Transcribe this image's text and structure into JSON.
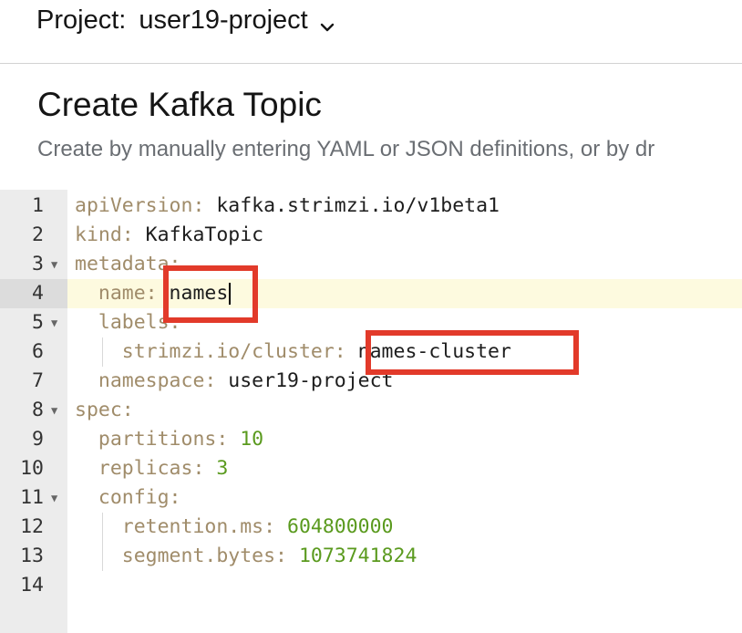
{
  "header": {
    "project_label": "Project:",
    "project_name": "user19-project",
    "chevron_icon": "chevron-down-icon"
  },
  "page": {
    "title": "Create Kafka Topic",
    "description": "Create by manually entering YAML or JSON definitions, or by dr"
  },
  "editor": {
    "lines": [
      {
        "num": "1",
        "key": "apiVersion:",
        "value": " kafka.strimzi.io/v1beta1"
      },
      {
        "num": "2",
        "key": "kind:",
        "value": " KafkaTopic"
      },
      {
        "num": "3",
        "key": "metadata:",
        "value": ""
      },
      {
        "num": "4",
        "key": "  name:",
        "value": " names"
      },
      {
        "num": "5",
        "key": "  labels:",
        "value": ""
      },
      {
        "num": "6",
        "key": "    strimzi.io/cluster:",
        "value": " names-cluster"
      },
      {
        "num": "7",
        "key": "  namespace:",
        "value": " user19-project"
      },
      {
        "num": "8",
        "key": "spec:",
        "value": ""
      },
      {
        "num": "9",
        "key": "  partitions:",
        "value": " 10"
      },
      {
        "num": "10",
        "key": "  replicas:",
        "value": " 3"
      },
      {
        "num": "11",
        "key": "  config:",
        "value": ""
      },
      {
        "num": "12",
        "key": "    retention.ms:",
        "value": " 604800000"
      },
      {
        "num": "13",
        "key": "    segment.bytes:",
        "value": " 1073741824"
      },
      {
        "num": "14",
        "key": "",
        "value": ""
      }
    ],
    "active_line": 4,
    "fold_icon": "fold-triangle-icon"
  },
  "colors": {
    "key": "#a08c6a",
    "number": "#5a9a1e",
    "highlight": "#e23a2a",
    "active_line": "#fdfadf"
  }
}
